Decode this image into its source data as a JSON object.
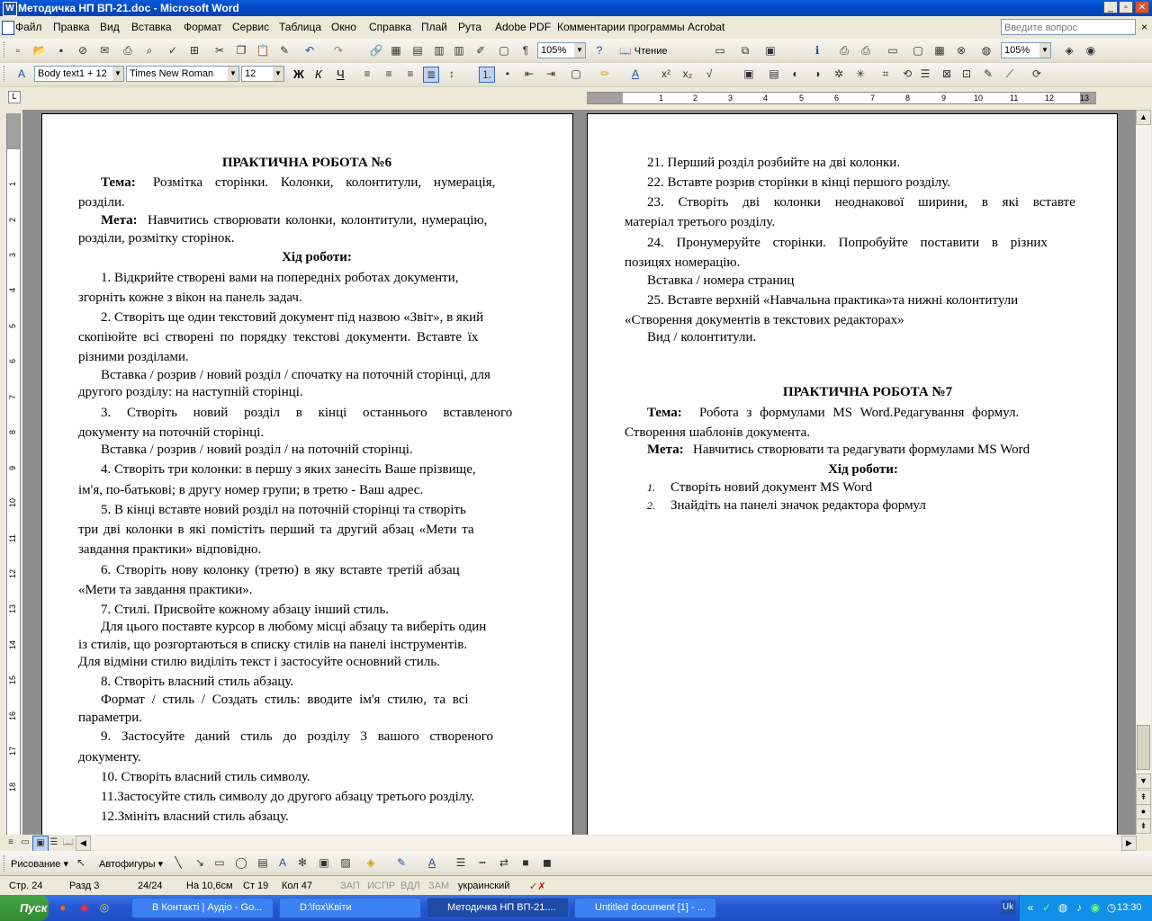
{
  "window": {
    "title": "Методичка НП ВП-21.doc - Microsoft Word",
    "app_icon_letter": "W",
    "minimize": "_",
    "maximize": "▫",
    "close": "✕"
  },
  "menu": {
    "items": [
      "Файл",
      "Правка",
      "Вид",
      "Вставка",
      "Формат",
      "Сервис",
      "Таблица",
      "Окно",
      "Справка",
      "Плай",
      "Рута",
      "Adobe PDF",
      "Комментарии программы Acrobat"
    ],
    "ask_placeholder": "Введите вопрос",
    "close_doc": "×"
  },
  "toolbar1": {
    "zoom": "105%",
    "reading_label": "Чтение",
    "zoom2": "105%"
  },
  "toolbar2": {
    "style": "Body text1 + 12",
    "font": "Times New Roman",
    "size": "12",
    "bold": "Ж",
    "italic": "К",
    "underline": "Ч"
  },
  "ruler": {
    "h_numbers": [
      "1",
      "2",
      "3",
      "4",
      "5",
      "6",
      "7",
      "8",
      "9",
      "10",
      "11",
      "12",
      "13"
    ],
    "v_numbers": [
      "1",
      "2",
      "3",
      "4",
      "5",
      "6",
      "7",
      "8",
      "9",
      "10",
      "11",
      "12",
      "13",
      "14",
      "15",
      "16",
      "17",
      "18"
    ]
  },
  "page_left": {
    "lines": [
      "ПРАКТИЧНА РОБОТА №6",
      "Тема:",
      "Розмітка сторінки. Колонки, колонтитули, нумерація,",
      "розділи.",
      "Мета:",
      "Навчитись створювати колонки, колонтитули, нумерацію,",
      "розділи, розмітку сторінок.",
      "Хід роботи:",
      "1.  Відкрийте створені вами на попередніх роботах документи,",
      "згорніть кожне з вікон на панель задач.",
      "2.  Створіть ще один текстовий документ під назвою «Звіт», в який",
      "скопіюйте всі створені по порядку текстові документи. Вставте їх",
      "різними розділами.",
      "Вставка / розрив / новий розділ / спочатку на поточній сторінці, для",
      "другого розділу: на наступній сторінці.",
      "3.  Створіть новий розділ в кінці останнього вставленого",
      "документу на поточній сторінці.",
      "Вставка / розрив / новий розділ / на поточній сторінці.",
      "4.  Створіть три колонки: в першу з яких занесіть Ваше прізвище,",
      "ім'я, по-батькові; в другу номер групи; в третю - Ваш адрес.",
      "5.  В кінці вставте новий розділ на поточній сторінці та створіть",
      "три дві колонки в які помістіть перший та другий абзац «Мети та",
      "завдання практики» відповідно.",
      "6.  Створіть нову колонку (третю) в яку вставте третій абзац",
      "«Мети та завдання практики».",
      "7.  Стилі. Присвойте кожному абзацу інший стиль.",
      "Для цього поставте курсор в любому місці абзацу та виберіть один",
      "із стилів, що розгортаються в списку стилів на панелі інструментів.",
      "Для відміни стилю виділіть текст і застосуйте основний стиль.",
      "8.  Створіть власний стиль абзацу.",
      "Формат / стиль / Создать стиль: вводите ім'я стилю, та всі",
      "параметри.",
      "9.  Застосуйте даний стиль до розділу 3 вашого створеного",
      "документу.",
      "10. Створіть власний стиль символу.",
      "11.Застосуйте стиль символу до другого абзацу третього розділу.",
      "12.Змініть власний стиль абзацу."
    ]
  },
  "page_right": {
    "lines": [
      "21. Перший розділ розбийте на дві колонки.",
      "22. Вставте розрив сторінки в кінці першого розділу.",
      "23. Створіть дві колонки неоднакової ширини, в які вставте",
      "матеріал третього розділу.",
      "24. Пронумеруйте сторінки. Попробуйте поставити в різних",
      "позицяx номерацію.",
      "Вставка / номера страниц",
      "25. Вставте верхній «Навчальна практика»та нижні колонтитули",
      "«Створення документів в текстових редакторах»",
      "Вид / колонтитули.",
      "ПРАКТИЧНА РОБОТА №7",
      "Тема:",
      "Робота з формулами MS Word.Редагування формул.",
      "Створення шаблонів документа.",
      "Мета:",
      "Навчитись створювати та редагувати формулами MS Word",
      "Хід роботи:",
      "1.",
      "Створіть новий документ MS Word",
      "2.",
      "Знайдіть на панелі значок редактора формул"
    ]
  },
  "drawbar": {
    "draw_label": "Рисование",
    "autoshapes_label": "Автофигуры"
  },
  "status": {
    "page": "Стр. 24",
    "section": "Разд 3",
    "pages": "24/24",
    "at": "На 10,6см",
    "line": "Ст 19",
    "col": "Кол 47",
    "rec": "ЗАП",
    "trk": "ИСПР",
    "ext": "ВДЛ",
    "ovr": "ЗАМ",
    "lang": "украинский"
  },
  "taskbar": {
    "start": "Пуск",
    "buttons": [
      "В Контакті | Аудіо - Go...",
      "D:\\fox\\Квіти",
      "Методичка НП ВП-21....",
      "Untitled document [1] - ..."
    ],
    "lang": "Uk",
    "clock": "13:30"
  },
  "colors": {
    "title_blue": "#0a5ad8",
    "taskbar_blue": "#2658d6",
    "start_green": "#3c9a3c"
  }
}
